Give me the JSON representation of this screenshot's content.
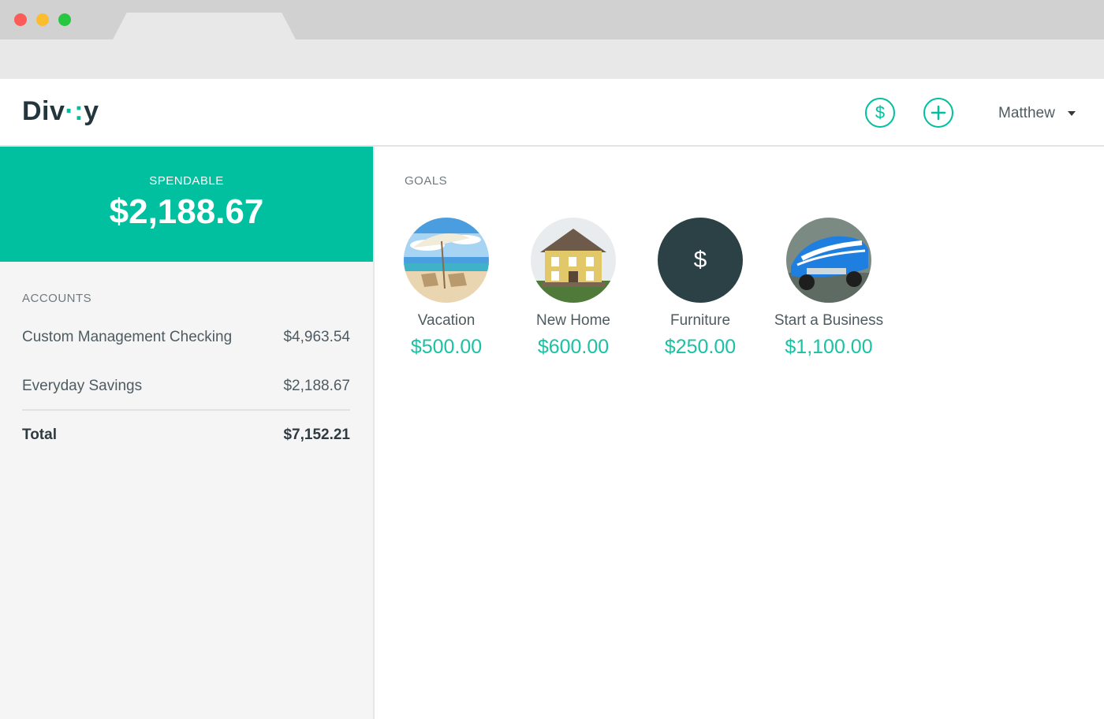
{
  "app": {
    "logo_text": "Div",
    "logo_dots": "·:",
    "logo_end": "y"
  },
  "header": {
    "dollar_icon": "dollar-circle-icon",
    "plus_icon": "plus-circle-icon",
    "dollar_glyph": "$",
    "user_name": "Matthew"
  },
  "spendable": {
    "label": "SPENDABLE",
    "amount": "$2,188.67"
  },
  "accounts": {
    "label": "ACCOUNTS",
    "items": [
      {
        "name": "Custom Management Checking",
        "amount": "$4,963.54"
      },
      {
        "name": "Everyday Savings",
        "amount": "$2,188.67"
      }
    ],
    "total_label": "Total",
    "total_amount": "$7,152.21"
  },
  "goals": {
    "label": "GOALS",
    "items": [
      {
        "name": "Vacation",
        "amount": "$500.00",
        "image": "beach-chairs-umbrella"
      },
      {
        "name": "New Home",
        "amount": "$600.00",
        "image": "yellow-house"
      },
      {
        "name": "Furniture",
        "amount": "$250.00",
        "image": "dollar-sign",
        "glyph": "$"
      },
      {
        "name": "Start a Business",
        "amount": "$1,100.00",
        "image": "blue-car"
      }
    ]
  },
  "colors": {
    "accent": "#00c09f",
    "amount": "#19c2a3",
    "dark": "#2b4146"
  }
}
